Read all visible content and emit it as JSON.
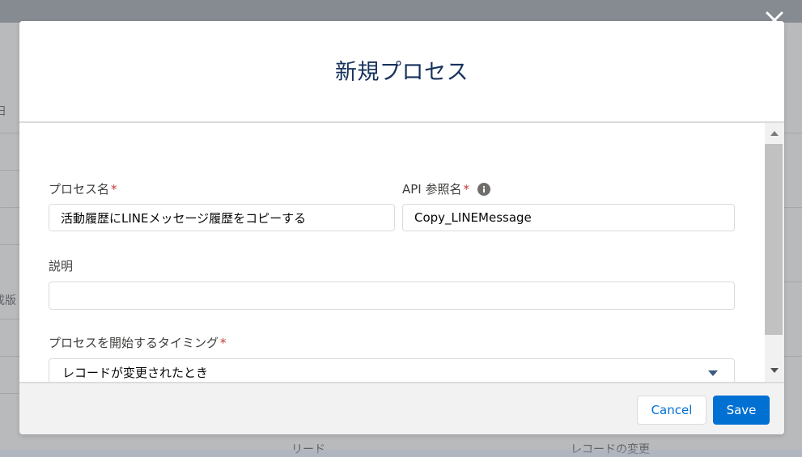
{
  "background": {
    "left_fragments": [
      "日",
      "成版"
    ],
    "bottom_fragments": [
      "リード",
      "レコードの変更"
    ]
  },
  "modal": {
    "title": "新規プロセス",
    "close_icon": "close-icon",
    "fields": {
      "process_name": {
        "label": "プロセス名",
        "required_mark": "*",
        "value": "活動履歴にLINEメッセージ履歴をコピーする"
      },
      "api_name": {
        "label": "API 参照名",
        "required_mark": "*",
        "info_icon": "info-icon",
        "value": "Copy_LINEMessage"
      },
      "description": {
        "label": "説明",
        "value": ""
      },
      "start_timing": {
        "label": "プロセスを開始するタイミング",
        "required_mark": "*",
        "selected": "レコードが変更されたとき"
      }
    },
    "footer": {
      "cancel_label": "Cancel",
      "save_label": "Save"
    }
  },
  "colors": {
    "brand_blue": "#0070d2",
    "title_navy": "#16325c",
    "required_red": "#c23934"
  }
}
